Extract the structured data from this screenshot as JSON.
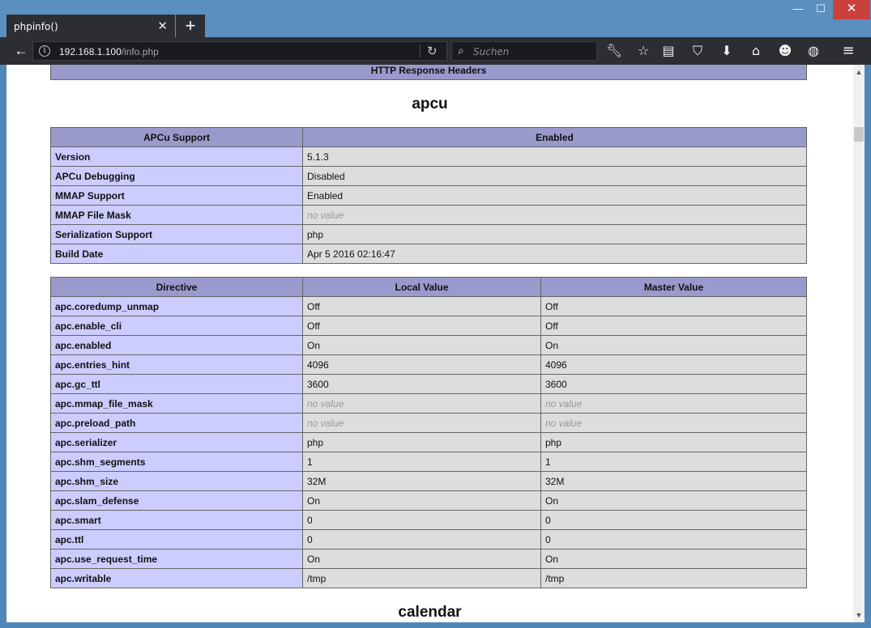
{
  "browser": {
    "tab_title": "phpinfo()",
    "url_host": "192.168.1.100",
    "url_path": "/info.php",
    "search_placeholder": "Suchen"
  },
  "page": {
    "top_header": "HTTP Response Headers",
    "section_apcu": "apcu",
    "section_calendar": "calendar",
    "support_table": {
      "header": [
        "APCu Support",
        "Enabled"
      ],
      "rows": [
        {
          "name": "Version",
          "value": "5.1.3"
        },
        {
          "name": "APCu Debugging",
          "value": "Disabled"
        },
        {
          "name": "MMAP Support",
          "value": "Enabled"
        },
        {
          "name": "MMAP File Mask",
          "value": "no value"
        },
        {
          "name": "Serialization Support",
          "value": "php"
        },
        {
          "name": "Build Date",
          "value": "Apr 5 2016 02:16:47"
        }
      ]
    },
    "directive_table": {
      "headers": [
        "Directive",
        "Local Value",
        "Master Value"
      ],
      "rows": [
        {
          "name": "apc.coredump_unmap",
          "local": "Off",
          "master": "Off"
        },
        {
          "name": "apc.enable_cli",
          "local": "Off",
          "master": "Off"
        },
        {
          "name": "apc.enabled",
          "local": "On",
          "master": "On"
        },
        {
          "name": "apc.entries_hint",
          "local": "4096",
          "master": "4096"
        },
        {
          "name": "apc.gc_ttl",
          "local": "3600",
          "master": "3600"
        },
        {
          "name": "apc.mmap_file_mask",
          "local": "no value",
          "master": "no value"
        },
        {
          "name": "apc.preload_path",
          "local": "no value",
          "master": "no value"
        },
        {
          "name": "apc.serializer",
          "local": "php",
          "master": "php"
        },
        {
          "name": "apc.shm_segments",
          "local": "1",
          "master": "1"
        },
        {
          "name": "apc.shm_size",
          "local": "32M",
          "master": "32M"
        },
        {
          "name": "apc.slam_defense",
          "local": "On",
          "master": "On"
        },
        {
          "name": "apc.smart",
          "local": "0",
          "master": "0"
        },
        {
          "name": "apc.ttl",
          "local": "0",
          "master": "0"
        },
        {
          "name": "apc.use_request_time",
          "local": "On",
          "master": "On"
        },
        {
          "name": "apc.writable",
          "local": "/tmp",
          "master": "/tmp"
        }
      ]
    }
  },
  "icons": {
    "tab_close": "close-icon",
    "new_tab": "plus-icon",
    "back": "arrow-left-icon",
    "info": "info-icon",
    "reload": "reload-icon",
    "search": "search-icon",
    "toolbar": [
      "wrench-icon",
      "star-icon",
      "reader-icon",
      "pocket-icon",
      "download-icon",
      "home-icon",
      "smiley-icon",
      "globe-icon",
      "menu-icon"
    ]
  }
}
